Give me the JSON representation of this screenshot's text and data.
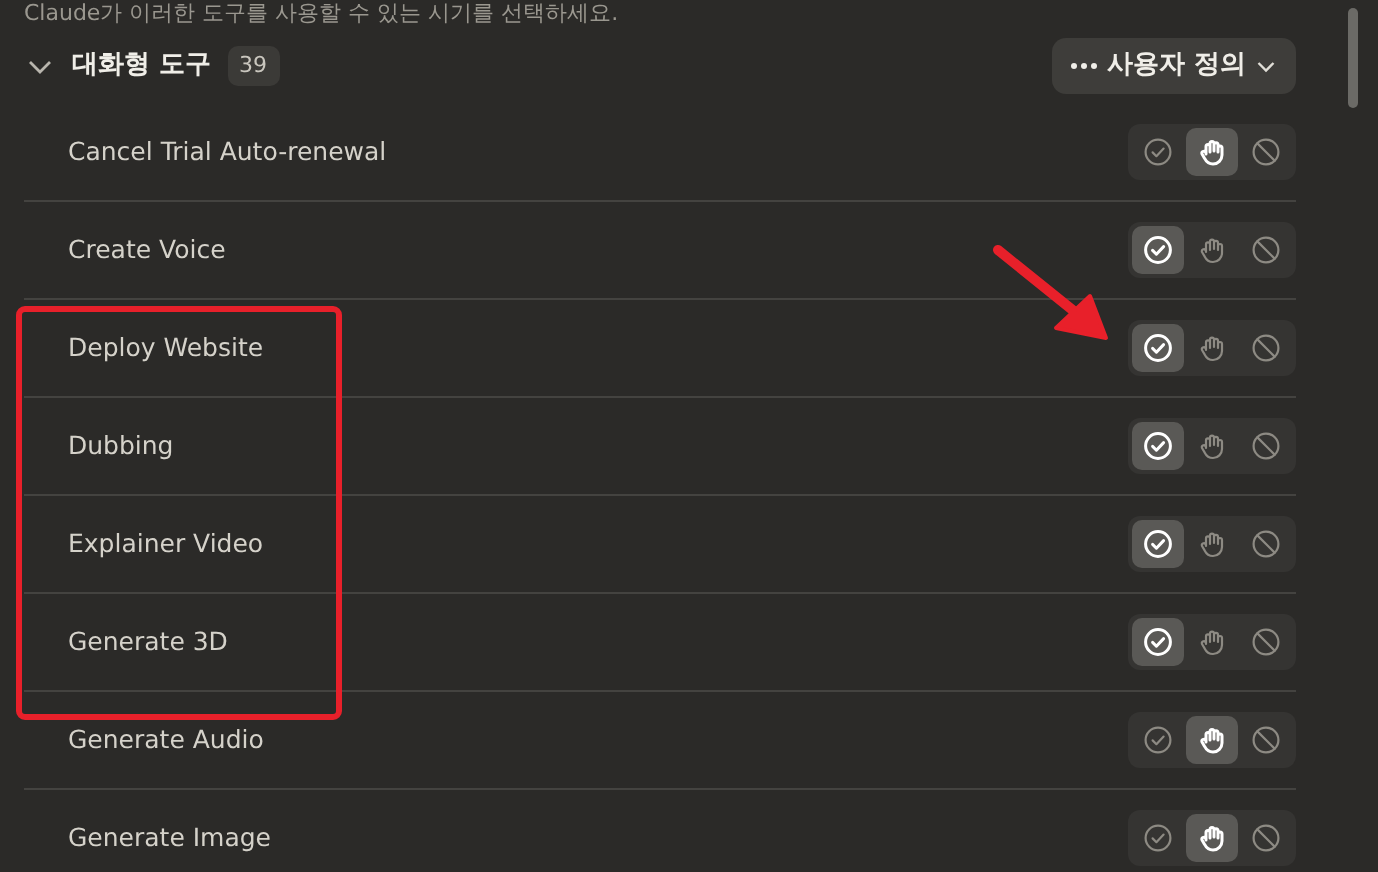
{
  "description": "Claude가 이러한 도구를 사용할 수 있는 시기를 선택하세요.",
  "section": {
    "title": "대화형 도구",
    "count": "39",
    "expanded": true,
    "menu_button": "사용자 정의"
  },
  "tools": [
    {
      "name": "Cancel Trial Auto-renewal",
      "options": [
        {
          "kind": "allow",
          "selected": false
        },
        {
          "kind": "ask",
          "selected": true
        },
        {
          "kind": "block",
          "selected": false
        }
      ]
    },
    {
      "name": "Create Voice",
      "options": [
        {
          "kind": "allow",
          "selected": true
        },
        {
          "kind": "ask",
          "selected": false
        },
        {
          "kind": "block",
          "selected": false
        }
      ]
    },
    {
      "name": "Deploy Website",
      "options": [
        {
          "kind": "allow",
          "selected": true
        },
        {
          "kind": "ask",
          "selected": false
        },
        {
          "kind": "block",
          "selected": false
        }
      ]
    },
    {
      "name": "Dubbing",
      "options": [
        {
          "kind": "allow",
          "selected": true
        },
        {
          "kind": "ask",
          "selected": false
        },
        {
          "kind": "block",
          "selected": false
        }
      ]
    },
    {
      "name": "Explainer Video",
      "options": [
        {
          "kind": "allow",
          "selected": true
        },
        {
          "kind": "ask",
          "selected": false
        },
        {
          "kind": "block",
          "selected": false
        }
      ]
    },
    {
      "name": "Generate 3D",
      "options": [
        {
          "kind": "allow",
          "selected": true
        },
        {
          "kind": "ask",
          "selected": false
        },
        {
          "kind": "block",
          "selected": false
        }
      ]
    },
    {
      "name": "Generate Audio",
      "options": [
        {
          "kind": "allow",
          "selected": false
        },
        {
          "kind": "ask",
          "selected": true
        },
        {
          "kind": "block",
          "selected": false
        }
      ]
    },
    {
      "name": "Generate Image",
      "options": [
        {
          "kind": "allow",
          "selected": false
        },
        {
          "kind": "ask",
          "selected": true
        },
        {
          "kind": "block",
          "selected": false
        }
      ]
    }
  ],
  "highlight_frame": {
    "color": "#e8202a"
  },
  "pointer_arrow": {
    "color": "#e8202a"
  }
}
